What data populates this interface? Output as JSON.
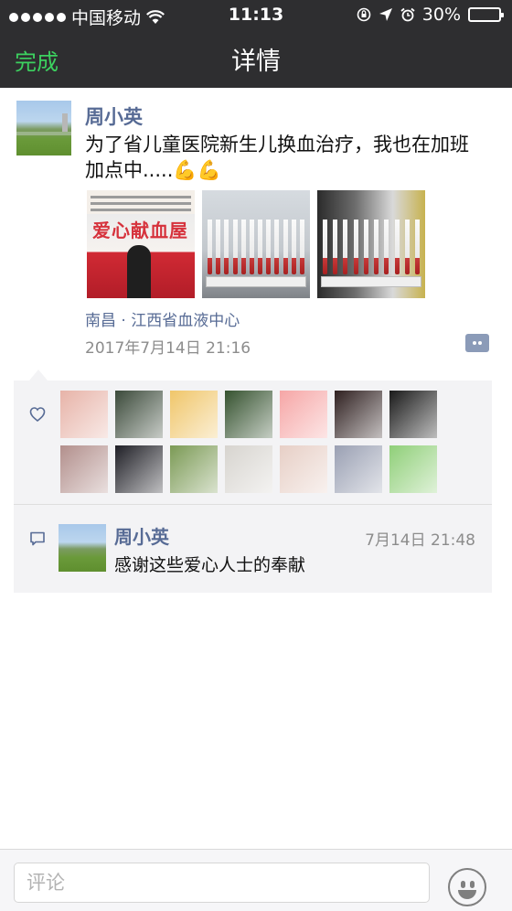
{
  "status_bar": {
    "carrier": "中国移动",
    "time": "11:13",
    "battery": "30%",
    "battery_level": 0.3
  },
  "nav": {
    "done_label": "完成",
    "title": "详情"
  },
  "post": {
    "author": "周小英",
    "text": "为了省儿童医院新生儿换血治疗，我也在加班加点中.....",
    "emojis": "💪💪",
    "photo1_sign": "爱心献血屋",
    "location": "南昌 · 江西省血液中心",
    "timestamp": "2017年7月14日 21:16"
  },
  "likes": {
    "icon": "heart-icon",
    "colors": [
      "#e7b3a8",
      "#3b4a3a",
      "#f0c66a",
      "#35522f",
      "#f6a6a6",
      "#2f2020",
      "#1a1a1a",
      "#b28f8c",
      "#1f1f26",
      "#7b9a55",
      "#d7d4cf",
      "#e7cfc6",
      "#9aa0b3",
      "#8fcf78"
    ]
  },
  "comments": [
    {
      "author": "周小英",
      "time": "7月14日 21:48",
      "text": "感谢这些爱心人士的奉献"
    }
  ],
  "input": {
    "placeholder": "评论"
  },
  "colors": {
    "nav_bg": "#2e2e30",
    "accent_green": "#3cd15f",
    "link_blue": "#576b95"
  }
}
